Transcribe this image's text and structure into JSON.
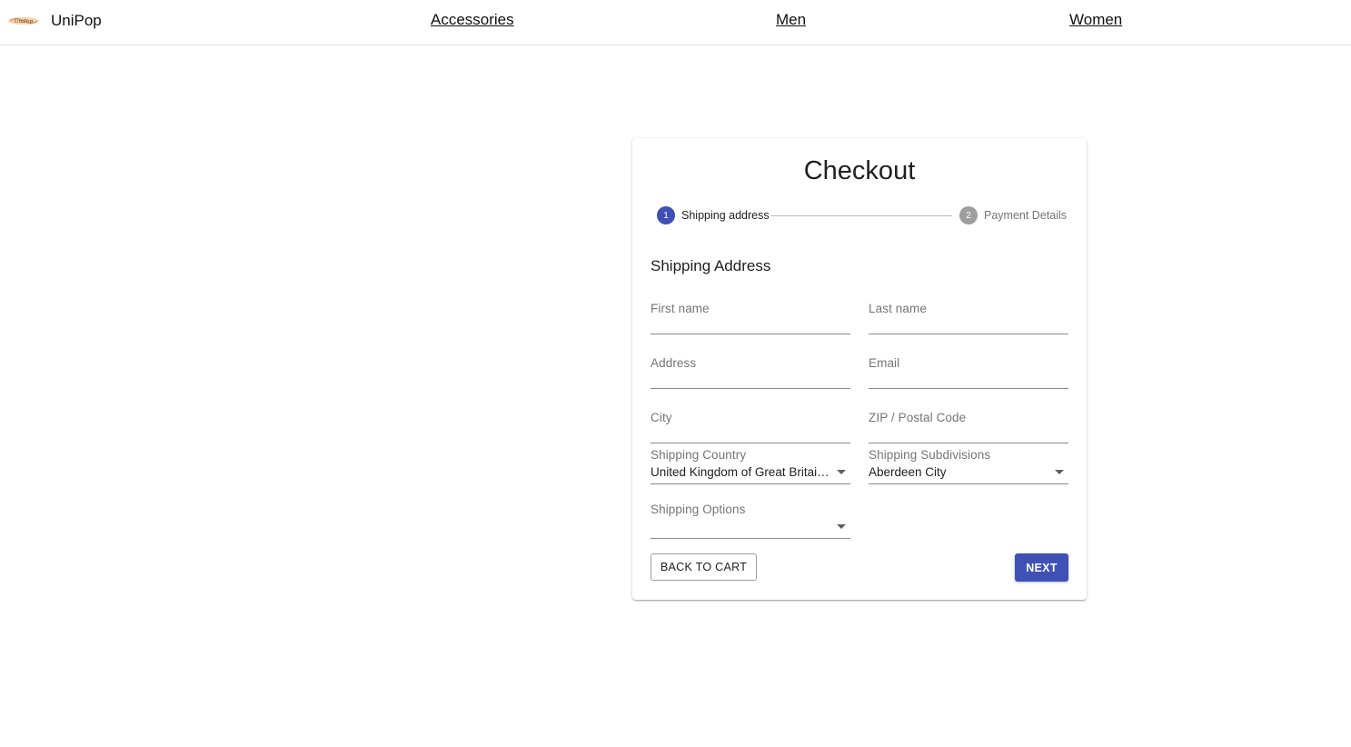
{
  "brand": {
    "name": "UniPop",
    "logo_icon": "unipop-logo-icon"
  },
  "nav": {
    "links": [
      "Accessories",
      "Men",
      "Women"
    ]
  },
  "checkout": {
    "title": "Checkout",
    "steps": [
      {
        "number": "1",
        "label": "Shipping address",
        "state": "active"
      },
      {
        "number": "2",
        "label": "Payment Details",
        "state": "inactive"
      }
    ],
    "section_title": "Shipping Address",
    "fields": {
      "first_name": {
        "label": "First name",
        "value": ""
      },
      "last_name": {
        "label": "Last name",
        "value": ""
      },
      "address": {
        "label": "Address",
        "value": ""
      },
      "email": {
        "label": "Email",
        "value": ""
      },
      "city": {
        "label": "City",
        "value": ""
      },
      "zip": {
        "label": "ZIP / Postal Code",
        "value": ""
      },
      "shipping_country": {
        "label": "Shipping Country",
        "value": "United Kingdom of Great Britain and Northern Ireland"
      },
      "shipping_subdivisions": {
        "label": "Shipping Subdivisions",
        "value": "Aberdeen City"
      },
      "shipping_options": {
        "label": "Shipping Options",
        "value": ""
      }
    },
    "buttons": {
      "back": "BACK TO CART",
      "next": "NEXT"
    }
  },
  "colors": {
    "primary": "#3f51b5",
    "step_inactive": "#9e9e9e",
    "label": "#757575"
  }
}
